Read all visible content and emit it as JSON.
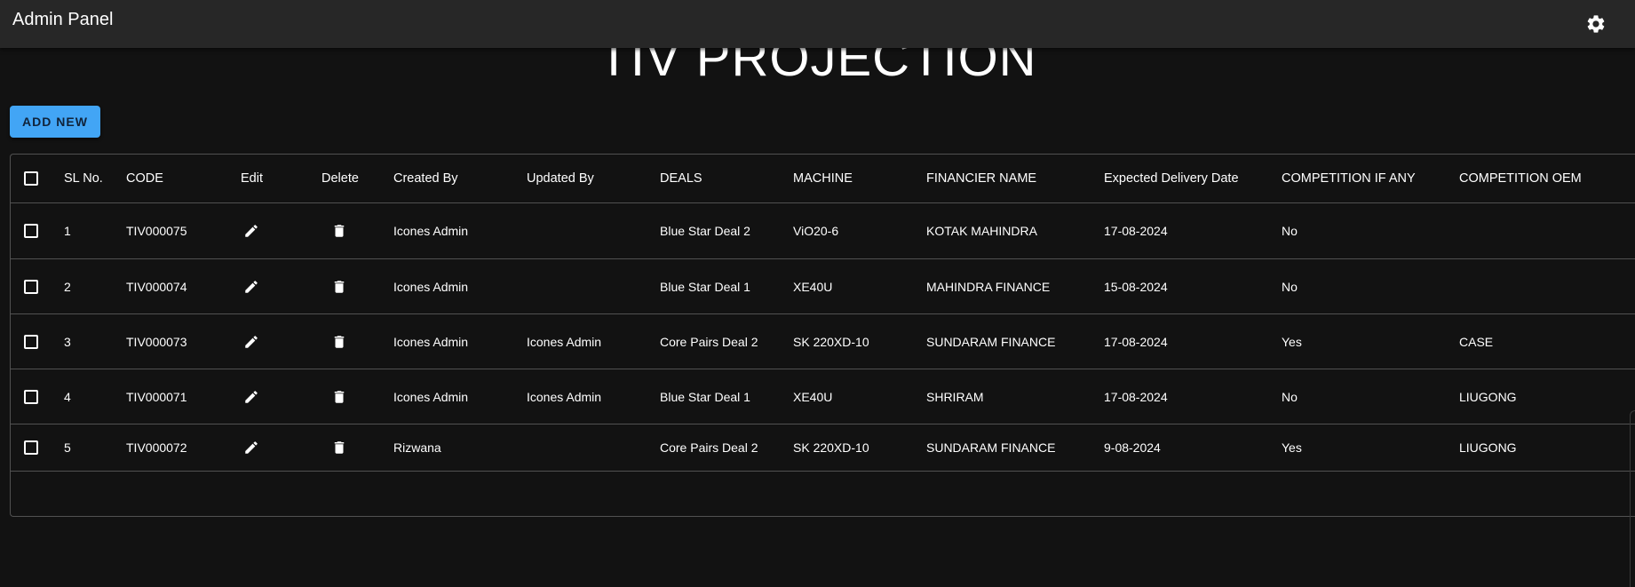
{
  "appbar": {
    "title": "Admin Panel",
    "settings_icon": "gear-icon"
  },
  "page": {
    "title": "TIV PROJECTION"
  },
  "toolbar": {
    "add_label": "ADD NEW",
    "add_color": "#42a5f5"
  },
  "table": {
    "headers": [
      "SL No.",
      "CODE",
      "Edit",
      "Delete",
      "Created By",
      "Updated By",
      "DEALS",
      "MACHINE",
      "FINANCIER NAME",
      "Expected Delivery Date",
      "COMPETITION IF ANY",
      "COMPETITION OEM"
    ],
    "rows": [
      {
        "sl": "1",
        "code": "TIV000075",
        "created_by": "Icones Admin",
        "updated_by": "",
        "deals": "Blue Star Deal 2",
        "machine": "ViO20-6",
        "financier": "KOTAK MAHINDRA",
        "delivery": "17-08-2024",
        "competition": "No",
        "oem": ""
      },
      {
        "sl": "2",
        "code": "TIV000074",
        "created_by": "Icones Admin",
        "updated_by": "",
        "deals": "Blue Star Deal 1",
        "machine": "XE40U",
        "financier": "MAHINDRA FINANCE",
        "delivery": "15-08-2024",
        "competition": "No",
        "oem": ""
      },
      {
        "sl": "3",
        "code": "TIV000073",
        "created_by": "Icones Admin",
        "updated_by": "Icones Admin",
        "deals": "Core Pairs Deal 2",
        "machine": "SK 220XD-10",
        "financier": "SUNDARAM FINANCE",
        "delivery": "17-08-2024",
        "competition": "Yes",
        "oem": "CASE"
      },
      {
        "sl": "4",
        "code": "TIV000071",
        "created_by": "Icones Admin",
        "updated_by": "Icones Admin",
        "deals": "Blue Star Deal 1",
        "machine": "XE40U",
        "financier": "SHRIRAM",
        "delivery": "17-08-2024",
        "competition": "No",
        "oem": "LIUGONG"
      },
      {
        "sl": "5",
        "code": "TIV000072",
        "created_by": "Rizwana",
        "updated_by": "",
        "deals": "Core Pairs Deal 2",
        "machine": "SK 220XD-10",
        "financier": "SUNDARAM FINANCE",
        "delivery": "9-08-2024",
        "competition": "Yes",
        "oem": "LIUGONG"
      }
    ]
  },
  "colors": {
    "background": "#121212",
    "appbar": "#272727",
    "divider": "#515151"
  }
}
